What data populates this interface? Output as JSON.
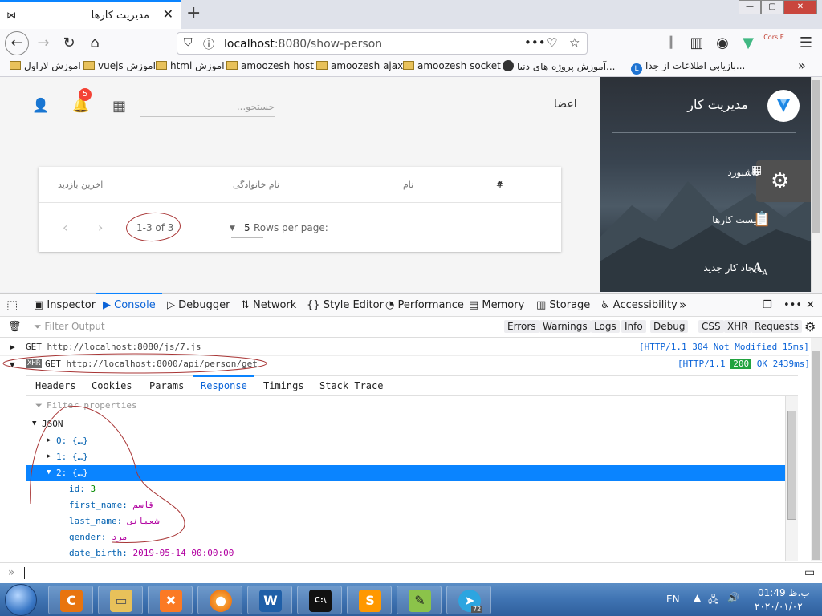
{
  "browser": {
    "tab_title": "مدیریت کارها",
    "tab_close": "✕",
    "new_tab": "+",
    "url_host": "localhost",
    "url_rest": ":8080/show-person",
    "window_min": "—",
    "window_max": "▢",
    "window_close": "✕",
    "cors_label": "Cors E",
    "overflow": "»"
  },
  "bookmarks": [
    {
      "label": "اموزش لاراول"
    },
    {
      "label": "vuejs اموزش"
    },
    {
      "label": "html اموزش"
    },
    {
      "label": "amoozesh host"
    },
    {
      "label": "amoozesh ajax"
    },
    {
      "label": "amoozesh socket"
    },
    {
      "label": "آموزش پروژه های دنیا..."
    },
    {
      "label": "بازیابی اطلاعات از جدا..."
    }
  ],
  "app": {
    "sidebar_title": "مدیریت کار",
    "menu": [
      {
        "label": "داشبورد"
      },
      {
        "label": "لیست کارها"
      },
      {
        "label": "ایجاد کار جدید"
      }
    ],
    "header_title": "اعضا",
    "search_placeholder": "جستجو...",
    "notification_count": "5",
    "table": {
      "columns": [
        "#",
        "نام",
        "نام خانوادگی",
        "اخرین بازدید"
      ],
      "rows_per_page_label": "Rows per page:",
      "rows_per_page_value": "5",
      "pagination": "1-3 of 3"
    }
  },
  "devtools": {
    "tabs": [
      "Inspector",
      "Console",
      "Debugger",
      "Network",
      "Style Editor",
      "Performance",
      "Memory",
      "Storage",
      "Accessibility"
    ],
    "filter_placeholder": "Filter Output",
    "filter_buttons": [
      "Errors",
      "Warnings",
      "Logs",
      "Info",
      "Debug",
      "CSS",
      "XHR",
      "Requests"
    ],
    "requests": [
      {
        "method": "GET",
        "url": "http://localhost:8080/js/7.js",
        "status": "[HTTP/1.1  304  Not Modified 15ms]"
      },
      {
        "badge": "XHR",
        "method": "GET",
        "url": "http://localhost:8000/api/person/get",
        "status_prefix": "[HTTP/1.1 ",
        "code": "200",
        "status_suffix": " OK 2439ms]"
      }
    ],
    "subtabs": [
      "Headers",
      "Cookies",
      "Params",
      "Response",
      "Timings",
      "Stack Trace"
    ],
    "prop_filter_placeholder": "Filter properties",
    "json_root": "JSON",
    "json_items": [
      {
        "key": "0:",
        "value": "{…}"
      },
      {
        "key": "1:",
        "value": "{…}"
      },
      {
        "key": "2:",
        "value": "{…}"
      }
    ],
    "json_fields": [
      {
        "key": "id:",
        "value": "3"
      },
      {
        "key": "first_name:",
        "value": "قاسم"
      },
      {
        "key": "last_name:",
        "value": "شعبانی"
      },
      {
        "key": "gender:",
        "value": "مرد"
      },
      {
        "key": "date_birth:",
        "value": "2019-05-14 00:00:00"
      }
    ],
    "prompt": "»"
  },
  "taskbar": {
    "lang": "EN",
    "time": "01:49 ب.ظ",
    "date": "۲۰۲۰/۰۱/۰۲",
    "telegram_badge": "72"
  },
  "colors": {
    "accent": "#0a84ff",
    "badge": "#f44336",
    "ok": "#21a33f",
    "annotation": "#a83535"
  }
}
